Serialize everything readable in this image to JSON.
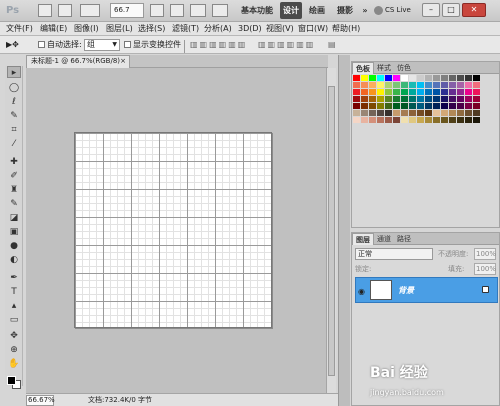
{
  "app": {
    "logo": "Ps",
    "zoom": "66.7",
    "workspaces": [
      "基本功能",
      "设计",
      "绘画",
      "摄影"
    ],
    "active_workspace": "设计",
    "more": "»",
    "cs_live": "CS Live",
    "window_buttons": [
      "–",
      "□",
      "✕"
    ]
  },
  "menu": [
    "文件(F)",
    "编辑(E)",
    "图像(I)",
    "图层(L)",
    "选择(S)",
    "滤镜(T)",
    "分析(A)",
    "3D(D)",
    "视图(V)",
    "窗口(W)",
    "帮助(H)"
  ],
  "options": {
    "auto_select_label": "自动选择:",
    "group_value": "组",
    "show_transform_label": "显示变换控件"
  },
  "document": {
    "tab_title": "未标题-1 @ 66.7%(RGB/8)",
    "zoom": "66.67%",
    "doc_info": "文档:732.4K/0 字节"
  },
  "swatches_panel": {
    "tabs": [
      "色板",
      "样式",
      "仿色"
    ]
  },
  "layers_panel": {
    "tabs": [
      "图层",
      "通道",
      "路径"
    ],
    "blend_mode": "正常",
    "opacity_label": "不透明度:",
    "opacity_value": "100%",
    "lock_label": "锁定:",
    "fill_label": "填充:",
    "fill_value": "100%",
    "layer_name": "背景"
  },
  "watermark": {
    "text": "Bai 经验",
    "url": "jingyan.baidu.com"
  }
}
